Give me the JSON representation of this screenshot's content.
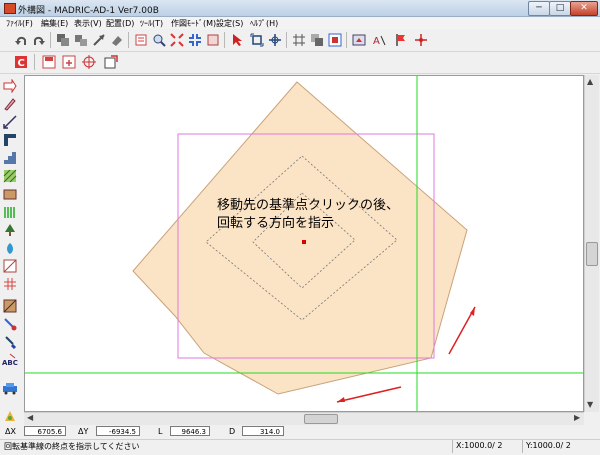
{
  "window": {
    "title": "外構図 - MADRIC-AD-1 Ver7.00B",
    "controls": {
      "minimize": "─",
      "maximize": "□",
      "close": "✕"
    }
  },
  "menu": {
    "items": [
      "ﾌｧｲﾙ(F)",
      "編集(E)",
      "表示(V)",
      "配置(D)",
      "ﾂｰﾙ(T)",
      "作図ﾓｰﾄﾞ(M)",
      "設定(S)",
      "ﾍﾙﾌﾟ(H)"
    ]
  },
  "toolbar1": {
    "icons": [
      "undo-icon",
      "redo-icon",
      "copy-shape-icon",
      "move-shape-icon",
      "line-arrow-icon",
      "eraser-icon",
      "print-preview-icon",
      "zoom-icon",
      "zoom-fit-icon",
      "zoom-window-icon",
      "redraw-icon",
      "select-pointer-icon",
      "frame-select-icon",
      "measure-icon",
      "grid-snap-icon",
      "layer-icon",
      "frame-icon",
      "text-style-icon",
      "flag-icon",
      "origin-icon"
    ]
  },
  "toolbar2": {
    "icons": [
      "command-c-icon",
      "save-icon",
      "save-as-icon",
      "target-icon",
      "export-icon"
    ]
  },
  "left_toolbar": {
    "icons": [
      "arrow-shape-icon",
      "pencil-icon",
      "dimension-icon",
      "wall-icon",
      "stairs-icon",
      "hatch-icon",
      "fence-icon",
      "block-icon",
      "column-icon",
      "tree-icon",
      "plant-icon",
      "slope-icon",
      "grid-icon",
      "tile-icon",
      "paint-icon",
      "text-abc-icon",
      "car-icon",
      "settings-icon"
    ]
  },
  "canvas": {
    "instruction_line1": "移動先の基準点クリックの後、",
    "instruction_line2": "回転する方向を指示",
    "colors": {
      "shape_fill": "#fbe3c5",
      "shape_stroke": "#c9a27a",
      "frame": "#e07ae0",
      "guide": "#22dd22",
      "marker": "#dd0000",
      "arrow": "#dd2222"
    }
  },
  "coords": {
    "dx_label": "ΔX",
    "dx_value": "6705.6",
    "dy_label": "ΔY",
    "dy_value": "-6934.5",
    "l_label": "L",
    "l_value": "9646.3",
    "d_label": "D",
    "d_value": "314.0"
  },
  "status": {
    "message": "回転基準線の終点を指示してください",
    "x_scale": "X:1000.0/ 2",
    "y_scale": "Y:1000.0/ 2"
  }
}
